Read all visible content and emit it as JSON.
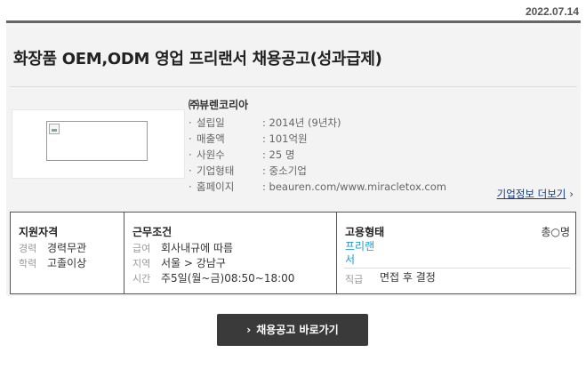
{
  "header": {
    "date": "2022.07.14"
  },
  "job": {
    "title": "화장품 OEM,ODM 영업 프리랜서 채용공고(성과급제)"
  },
  "company": {
    "name": "㈜뷰렌코리아",
    "logo_alt": "broken-image-icon",
    "info": [
      {
        "label": "설립일",
        "value": "2014년 (9년차)"
      },
      {
        "label": "매출액",
        "value": "101억원"
      },
      {
        "label": "사원수",
        "value": "25 명"
      },
      {
        "label": "기업형태",
        "value": "중소기업"
      },
      {
        "label": "홈페이지",
        "value": "beauren.com/www.miracletox.com"
      }
    ],
    "more_link": "기업정보 더보기",
    "more_chevron": "›"
  },
  "conditions": {
    "qualification": {
      "heading": "지원자격",
      "career_label": "경력",
      "career_value": "경력무관",
      "education_label": "학력",
      "education_value": "고졸이상"
    },
    "work": {
      "heading": "근무조건",
      "salary_label": "급여",
      "salary_value": "회사내규에 따름",
      "region_label": "지역",
      "region_value": "서울 > 강남구",
      "time_label": "시간",
      "time_value": "주5일(월~금)08:50~18:00"
    },
    "employment": {
      "heading": "고용형태",
      "headcount": "총○명",
      "type_line1": "프리랜",
      "type_line2": "서",
      "position_label": "직급",
      "position_value": "면접 후 결정"
    }
  },
  "actions": {
    "go_button": "채용공고 바로가기",
    "go_chevron": "›"
  }
}
